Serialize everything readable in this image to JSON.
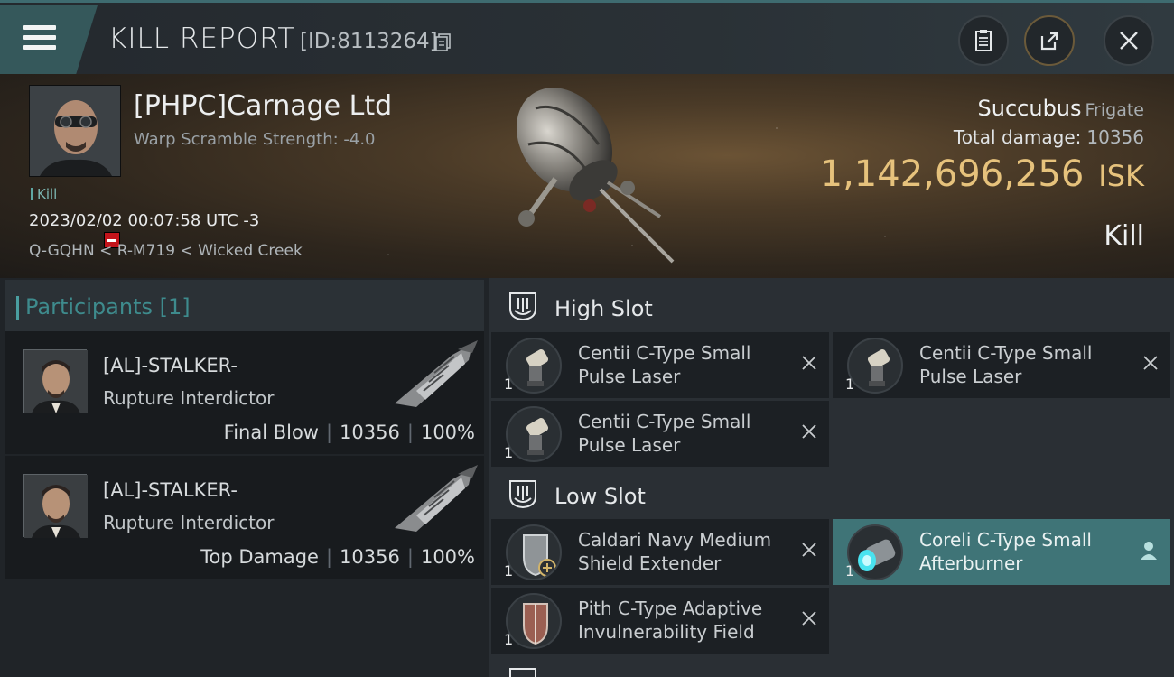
{
  "header": {
    "title": "KILL REPORT",
    "report_id": "[ID:8113264]"
  },
  "victim": {
    "name": "[PHPC]Carnage Ltd",
    "attribute": "Warp Scramble Strength: -4.0",
    "tag": "Kill",
    "time": "2023/02/02 00:07:58 UTC -3",
    "location": "Q-GQHN < R-M719 < Wicked Creek",
    "ship": "Succubus",
    "ship_class": "Frigate",
    "total_damage_label": "Total damage:",
    "total_damage": "10356",
    "isk_value": "1,142,696,256",
    "isk_unit": "ISK",
    "result": "Kill"
  },
  "participants": {
    "header": "Participants [1]",
    "list": [
      {
        "name": "[AL]-STALKER-",
        "ship": "Rupture Interdictor",
        "role": "Final Blow",
        "damage": "10356",
        "percent": "100%"
      },
      {
        "name": "[AL]-STALKER-",
        "ship": "Rupture Interdictor",
        "role": "Top Damage",
        "damage": "10356",
        "percent": "100%"
      }
    ]
  },
  "fitting": {
    "high_slot_title": "High Slot",
    "high_slot": [
      {
        "qty": "1",
        "name": "Centii C-Type Small Pulse Laser"
      },
      {
        "qty": "1",
        "name": "Centii C-Type Small Pulse Laser"
      },
      {
        "qty": "1",
        "name": "Centii C-Type Small Pulse Laser"
      }
    ],
    "low_slot_title": "Low Slot",
    "low_slot": [
      {
        "qty": "1",
        "name": "Caldari Navy Medium Shield Extender"
      },
      {
        "qty": "1",
        "name": "Coreli C-Type Small Afterburner"
      },
      {
        "qty": "1",
        "name": "Pith C-Type Adaptive Invulnerability Field"
      }
    ]
  },
  "colors": {
    "accent_teal": "#3f7477",
    "isk_gold": "#e6c27c",
    "standing_red": "#c3141b"
  }
}
